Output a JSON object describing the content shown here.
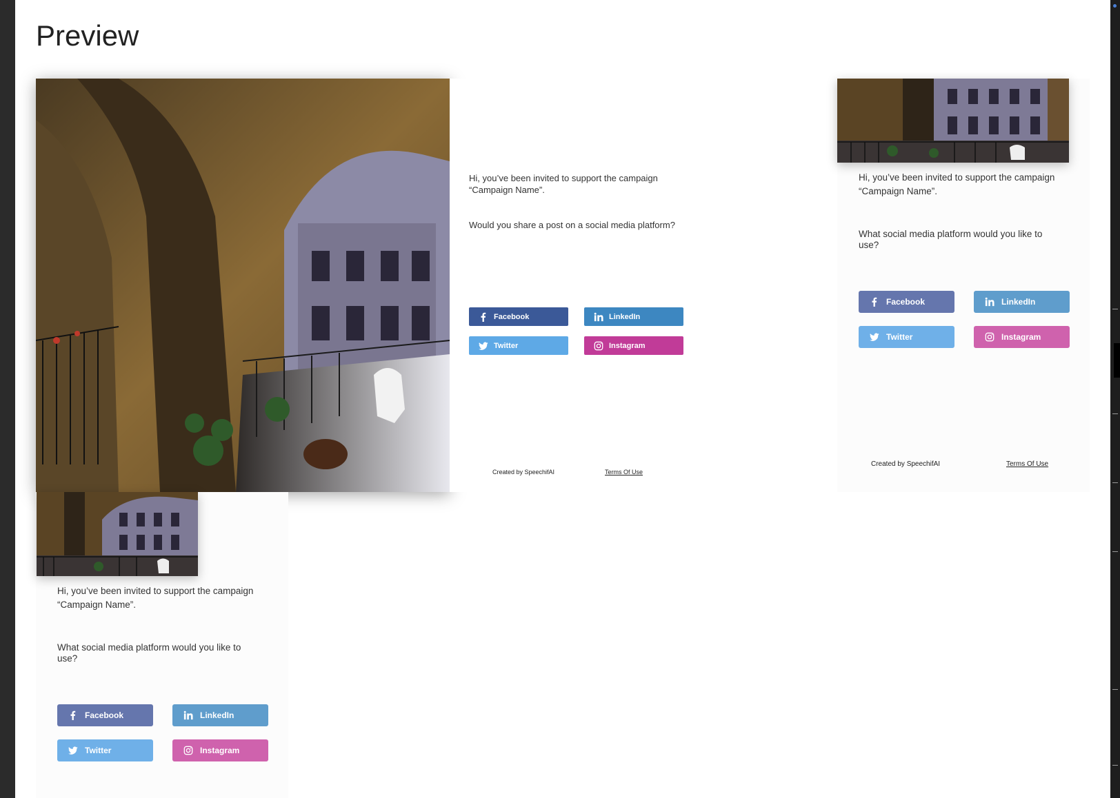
{
  "page": {
    "title": "Preview"
  },
  "campaign": {
    "invite_text": "Hi, you’ve been invited to support the campaign “Campaign Name”."
  },
  "desktop": {
    "question": "Would you share a post on a social media platform?",
    "buttons": {
      "facebook": "Facebook",
      "linkedin": "LinkedIn",
      "twitter": "Twitter",
      "instagram": "Instagram"
    },
    "footer": {
      "created_by": "Created by SpeechifAI",
      "terms": "Terms Of Use"
    }
  },
  "tablet": {
    "question": "What social media platform would you like to use?",
    "buttons": {
      "facebook": "Facebook",
      "linkedin": "LinkedIn",
      "twitter": "Twitter",
      "instagram": "Instagram"
    },
    "footer": {
      "created_by": "Created by SpeechifAI",
      "terms": "Terms Of Use"
    }
  },
  "mobile": {
    "question": "What social media platform would you like to use?",
    "buttons": {
      "facebook": "Facebook",
      "linkedin": "LinkedIn",
      "twitter": "Twitter",
      "instagram": "Instagram"
    }
  },
  "colors": {
    "facebook": "#3b5998",
    "linkedin": "#3d87c1",
    "twitter": "#5ea9e6",
    "instagram": "#c13b98"
  },
  "icons": {
    "facebook": "facebook-icon",
    "linkedin": "linkedin-icon",
    "twitter": "twitter-icon",
    "instagram": "instagram-icon"
  }
}
